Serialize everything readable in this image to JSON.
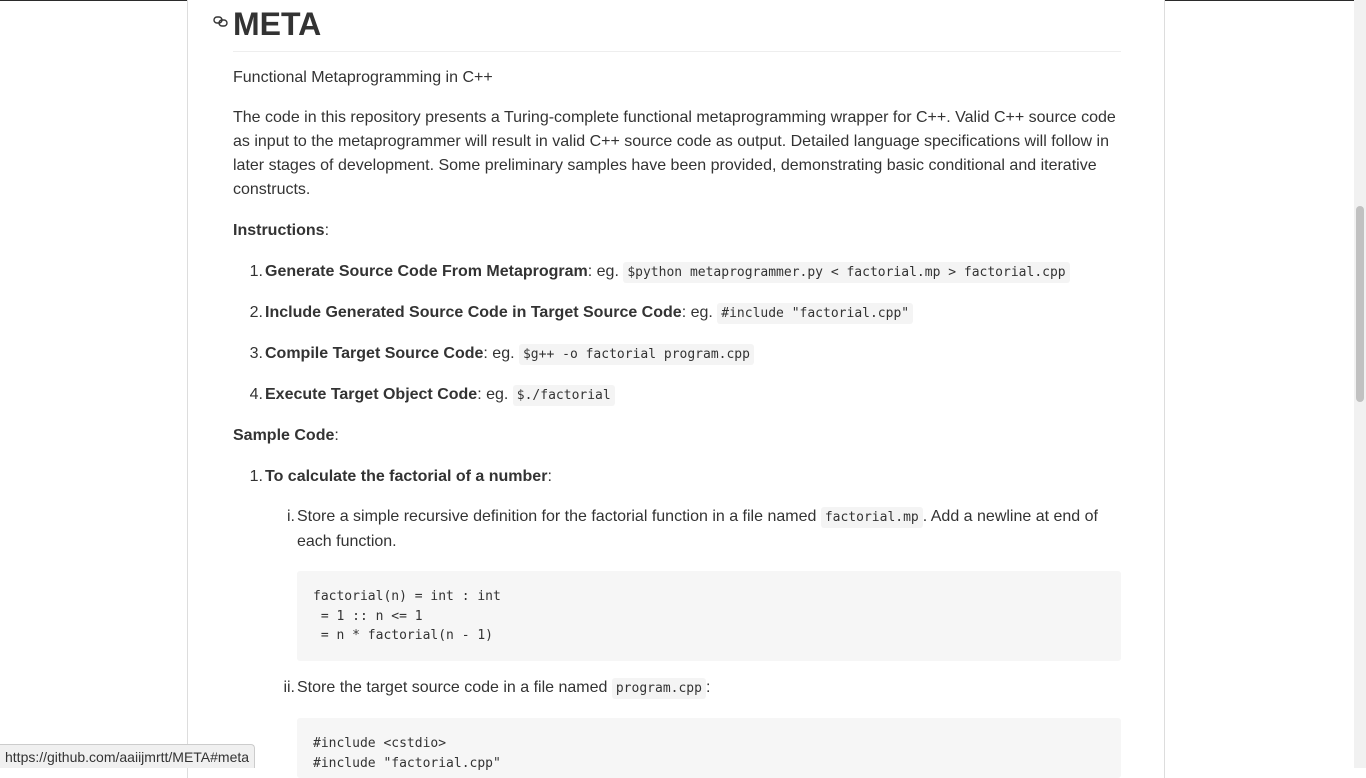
{
  "readme": {
    "title": "META",
    "subtitle": "Functional Metaprogramming in C++",
    "description": "The code in this repository presents a Turing-complete functional metaprogramming wrapper for C++. Valid C++ source code as input to the metaprogrammer will result in valid C++ source code as output. Detailed language specifications will follow in later stages of development. Some preliminary samples have been provided, demonstrating basic conditional and iterative constructs.",
    "instructions_heading": "Instructions",
    "colon": ":",
    "eg": ": eg. ",
    "instructions": [
      {
        "num": "1.",
        "label": "Generate Source Code From Metaprogram",
        "code": "$python metaprogrammer.py < factorial.mp > factorial.cpp"
      },
      {
        "num": "2.",
        "label": "Include Generated Source Code in Target Source Code",
        "code": "#include \"factorial.cpp\""
      },
      {
        "num": "3.",
        "label": "Compile Target Source Code",
        "code": "$g++ -o factorial program.cpp"
      },
      {
        "num": "4.",
        "label": "Execute Target Object Code",
        "code": "$./factorial"
      }
    ],
    "sample_heading": "Sample Code",
    "samples": [
      {
        "num": "1.",
        "label": "To calculate the factorial of a number",
        "steps": [
          {
            "num": "i.",
            "text_before": "Store a simple recursive definition for the factorial function in a file named ",
            "code": "factorial.mp",
            "text_after": ". Add a newline at end of each function.",
            "block": "factorial(n) = int : int\n = 1 :: n <= 1\n = n * factorial(n - 1)"
          },
          {
            "num": "ii.",
            "text_before": "Store the target source code in a file named ",
            "code": "program.cpp",
            "text_after": ":",
            "block": "#include <cstdio>\n#include \"factorial.cpp\""
          }
        ]
      }
    ]
  },
  "status_bar": {
    "url": "https://github.com/aaiijmrtt/META#meta"
  },
  "colors": {
    "text": "#333333",
    "code_bg": "#f6f6f6",
    "border": "#dddddd"
  }
}
